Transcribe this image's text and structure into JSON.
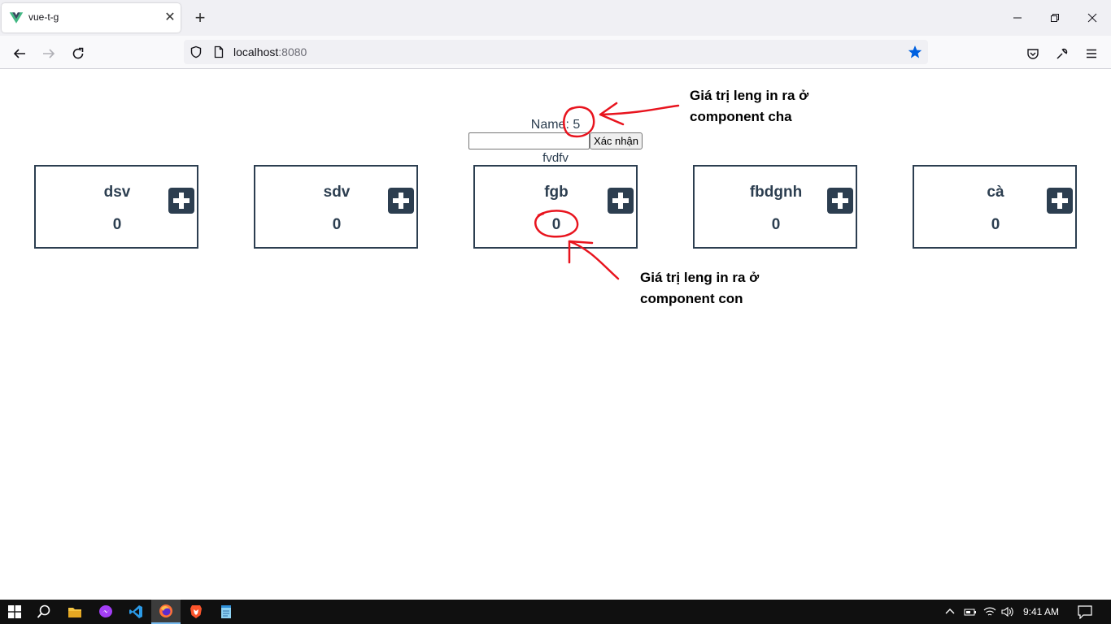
{
  "browser": {
    "tab_title": "vue-t-g",
    "url_host": "localhost",
    "url_port": ":8080"
  },
  "page": {
    "name_label": "Name: 5",
    "input_value": "",
    "confirm_label": "Xác nhận",
    "echo_text": "fvdfv",
    "cards": [
      {
        "title": "dsv",
        "count": "0"
      },
      {
        "title": "sdv",
        "count": "0"
      },
      {
        "title": "fgb",
        "count": "0"
      },
      {
        "title": "fbdgnh",
        "count": "0"
      },
      {
        "title": "cà",
        "count": "0"
      }
    ]
  },
  "annotations": {
    "parent_line1": "Giá trị leng in ra ở",
    "parent_line2": "component cha",
    "child_line1": "Giá trị leng in ra ở",
    "child_line2": "component con",
    "ink_color": "#e8141e"
  },
  "taskbar": {
    "clock": "9:41 AM",
    "apps": [
      "windows-start-icon",
      "search-icon",
      "file-explorer-icon",
      "messenger-icon",
      "vscode-icon",
      "firefox-icon",
      "brave-icon",
      "notepad-icon"
    ]
  },
  "colors": {
    "vue_text": "#2c3e50",
    "bookmark_star": "#0061e0"
  }
}
